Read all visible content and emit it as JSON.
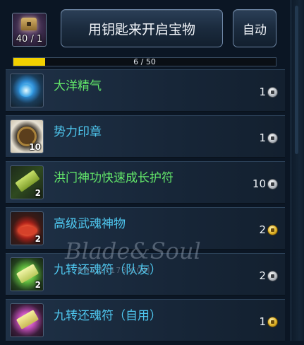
{
  "header": {
    "key_count": "40 / 1",
    "open_button_label": "用钥匙来开启宝物",
    "auto_button_label": "自动"
  },
  "progress": {
    "label": "6 / 50",
    "fraction": 0.12
  },
  "items": [
    {
      "name": "大洋精气",
      "name_color": "#63e86a",
      "icon": "ocean-essence-icon",
      "qty": "",
      "cost": "1",
      "currency": "silver"
    },
    {
      "name": "势力印章",
      "name_color": "#4fc8f0",
      "icon": "faction-seal-icon",
      "qty": "10",
      "cost": "1",
      "currency": "silver"
    },
    {
      "name": "洪门神功快速成长护符",
      "name_color": "#63e86a",
      "icon": "growth-talisman-icon",
      "qty": "2",
      "cost": "10",
      "currency": "silver"
    },
    {
      "name": "高级武魂神物",
      "name_color": "#4fc8f0",
      "icon": "martial-soul-relic-icon",
      "qty": "2",
      "cost": "2",
      "currency": "gold"
    },
    {
      "name": "九转还魂符（队友）",
      "name_color": "#4fc8f0",
      "icon": "revival-charm-team-icon",
      "qty": "2",
      "cost": "2",
      "currency": "silver"
    },
    {
      "name": "九转还魂符（自用）",
      "name_color": "#4fc8f0",
      "icon": "revival-charm-self-icon",
      "qty": "",
      "cost": "1",
      "currency": "gold"
    }
  ],
  "watermark": {
    "title": "Blade&Soul",
    "site": "BNS.17173.COM"
  }
}
